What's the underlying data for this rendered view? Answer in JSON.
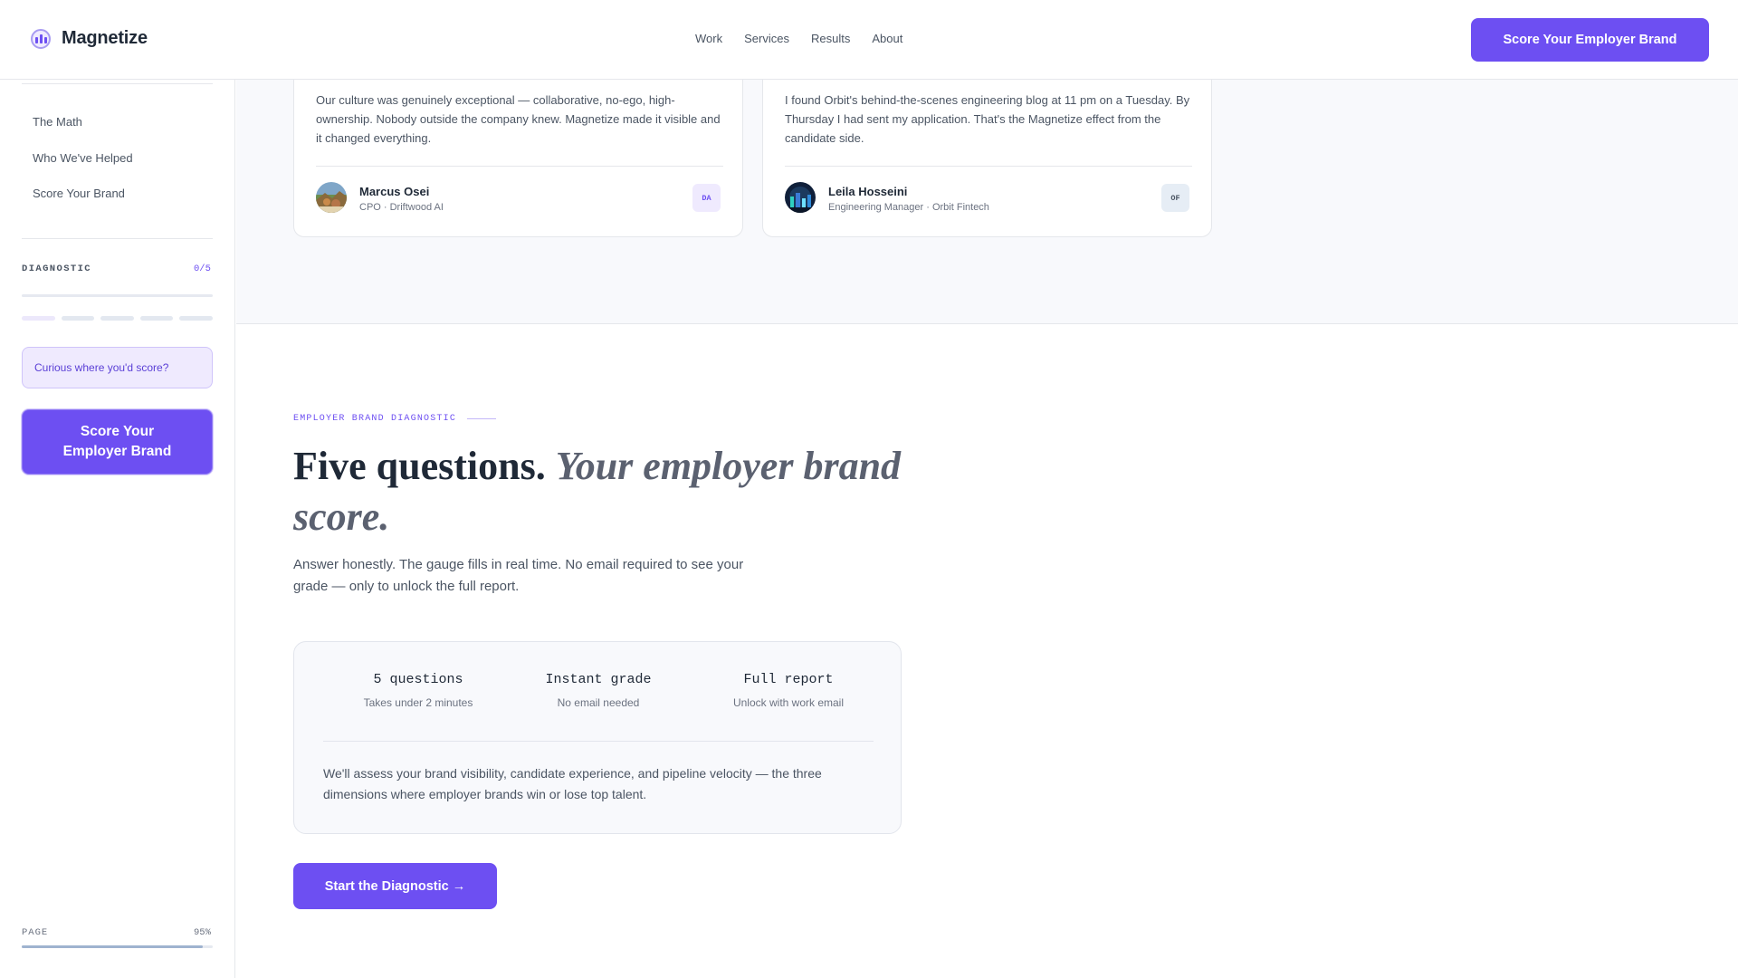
{
  "header": {
    "brand": "Magnetize",
    "nav": [
      "Work",
      "Services",
      "Results",
      "About"
    ],
    "cta": "Score Your Employer Brand"
  },
  "sidebar": {
    "links": [
      "The Math",
      "Who We've Helped",
      "Score Your Brand"
    ],
    "diagnostic_label": "DIAGNOSTIC",
    "diagnostic_count": "0/5",
    "diagnostic_progress": 0,
    "curious": "Curious where you'd score?",
    "cta": "Score Your Employer Brand",
    "page_label": "PAGE",
    "page_pct": "95%",
    "page_progress": 0.95
  },
  "testimonials": [
    {
      "quote": "Our culture was genuinely exceptional — collaborative, no-ego, high-ownership. Nobody outside the company knew. Magnetize made it visible and it changed everything.",
      "name": "Marcus Osei",
      "role": "CPO · Driftwood AI",
      "badge": "DA",
      "avatar_icon": "landscape-photo"
    },
    {
      "quote": "I found Orbit's behind-the-scenes engineering blog at 11 pm on a Tuesday. By Thursday I had sent my application. That's the Magnetize effect from the candidate side.",
      "name": "Leila Hosseini",
      "role": "Engineering Manager · Orbit Fintech",
      "badge": "OF",
      "avatar_icon": "city-night-photo"
    }
  ],
  "main": {
    "eyebrow": "EMPLOYER BRAND DIAGNOSTIC",
    "headline_plain": "Five questions.",
    "headline_italic": "Your employer brand score.",
    "sub": "Answer honestly. The gauge fills in real time. No email required to see your grade — only to unlock the full report.",
    "features": [
      {
        "title": "5 questions",
        "sub": "Takes under 2 minutes"
      },
      {
        "title": "Instant grade",
        "sub": "No email needed"
      },
      {
        "title": "Full report",
        "sub": "Unlock with work email"
      }
    ],
    "info": "We'll assess your brand visibility, candidate experience, and pipeline velocity — the three dimensions where employer brands win or lose top talent.",
    "start": "Start the Diagnostic →"
  },
  "colors": {
    "accent": "#6d4ff2",
    "accent_soft": "#efeafe"
  }
}
